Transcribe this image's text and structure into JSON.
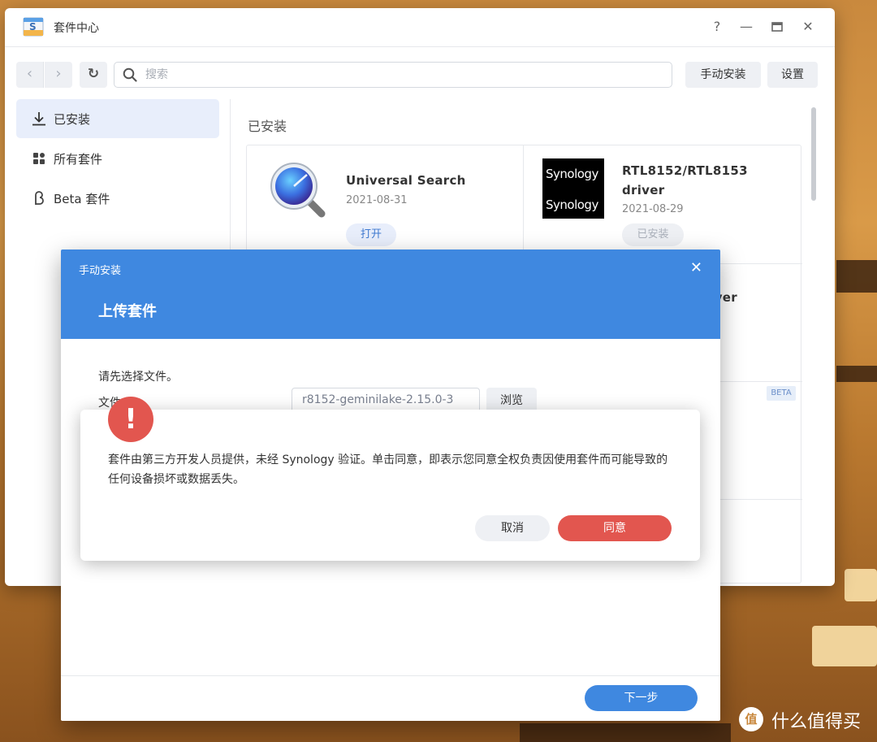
{
  "window": {
    "title": "套件中心",
    "controls": {
      "help": "?",
      "minimize": "—",
      "maximize": "🗖",
      "close": "✕"
    }
  },
  "toolbar": {
    "search_placeholder": "搜索",
    "manual_install_label": "手动安装",
    "settings_label": "设置"
  },
  "sidebar": {
    "items": [
      {
        "label": "已安装",
        "icon": "download-icon",
        "active": true
      },
      {
        "label": "所有套件",
        "icon": "grid-icon",
        "active": false
      },
      {
        "label": "Beta 套件",
        "icon": "beta-icon",
        "active": false
      }
    ]
  },
  "main": {
    "section_title": "已安装",
    "packages": [
      {
        "name": "Universal Search",
        "date": "2021-08-31",
        "action": "打开",
        "icon": "magnifier-icon"
      },
      {
        "name_line1": "RTL8152/RTL8153",
        "name_line2": "driver",
        "date": "2021-08-29",
        "action": "已安装",
        "icon": "synology-logo",
        "logo_text": "Synology"
      }
    ],
    "partial_text": "rver",
    "beta_tag": "BETA"
  },
  "modal": {
    "caption": "手动安装",
    "close": "✕",
    "heading": "上传套件",
    "instruction": "请先选择文件。",
    "file_label": "文件",
    "file_value": "r8152-geminilake-2.15.0-3",
    "browse_label": "浏览",
    "next_label": "下一步"
  },
  "alert": {
    "icon_glyph": "!",
    "message": "套件由第三方开发人员提供，未经 Synology 验证。单击同意，即表示您同意全权负责因使用套件而可能导致的任何设备损坏或数据丢失。",
    "cancel_label": "取消",
    "agree_label": "同意"
  },
  "watermark": {
    "glyph": "值",
    "text": "什么值得买"
  },
  "colors": {
    "accent": "#3f88e0",
    "danger": "#e2564f",
    "active_bg": "#e8eefb"
  }
}
